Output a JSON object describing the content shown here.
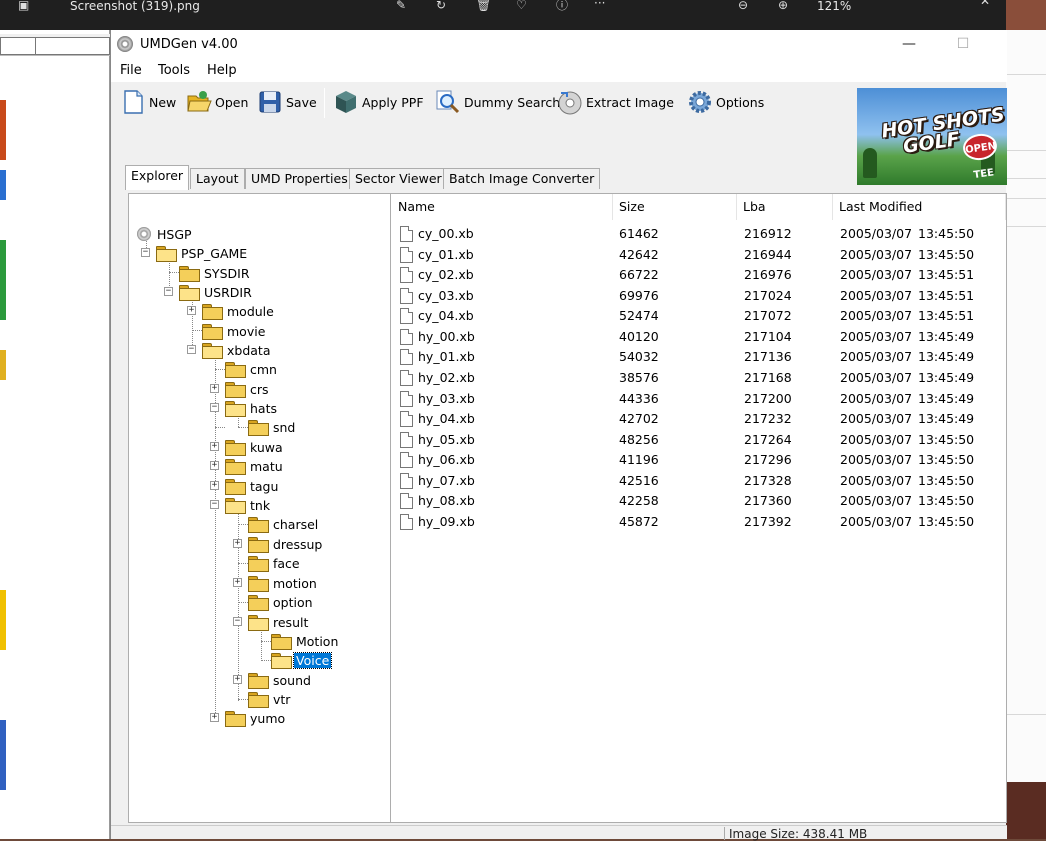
{
  "viewer": {
    "filename": "Screenshot (319).png",
    "zoom": "121%"
  },
  "window": {
    "title": "UMDGen v4.00",
    "minimize_glyph": "—",
    "maximize_glyph": "☐"
  },
  "menu": [
    "File",
    "Tools",
    "Help"
  ],
  "toolbar": {
    "new": "New",
    "open": "Open",
    "save": "Save",
    "apply_ppf": "Apply PPF",
    "dummy_search": "Dummy Search",
    "extract_image": "Extract Image",
    "options": "Options"
  },
  "banner": {
    "line1": "HOT SHOTS",
    "line2": "GOLF",
    "badge": "OPEN TEE"
  },
  "tabs": [
    "Explorer",
    "Layout",
    "UMD Properties",
    "Sector Viewer",
    "Batch Image Converter"
  ],
  "tree": {
    "root": "HSGP",
    "psp_game": "PSP_GAME",
    "sysdir": "SYSDIR",
    "usrdir": "USRDIR",
    "module": "module",
    "movie": "movie",
    "xbdata": "xbdata",
    "cmn": "cmn",
    "crs": "crs",
    "hats": "hats",
    "snd": "snd",
    "kuwa": "kuwa",
    "matu": "matu",
    "tagu": "tagu",
    "tnk": "tnk",
    "charsel": "charsel",
    "dressup": "dressup",
    "face": "face",
    "motion": "motion",
    "option": "option",
    "result": "result",
    "Motion": "Motion",
    "Voice": "Voice",
    "sound": "sound",
    "vtr": "vtr",
    "yumo": "yumo"
  },
  "list": {
    "headers": [
      "Name",
      "Size",
      "Lba",
      "Last Modified"
    ],
    "rows": [
      {
        "name": "cy_00.xb",
        "size": "61462",
        "lba": "216912",
        "date": "2005/03/07",
        "time": "13:45:50"
      },
      {
        "name": "cy_01.xb",
        "size": "42642",
        "lba": "216944",
        "date": "2005/03/07",
        "time": "13:45:50"
      },
      {
        "name": "cy_02.xb",
        "size": "66722",
        "lba": "216976",
        "date": "2005/03/07",
        "time": "13:45:51"
      },
      {
        "name": "cy_03.xb",
        "size": "69976",
        "lba": "217024",
        "date": "2005/03/07",
        "time": "13:45:51"
      },
      {
        "name": "cy_04.xb",
        "size": "52474",
        "lba": "217072",
        "date": "2005/03/07",
        "time": "13:45:51"
      },
      {
        "name": "hy_00.xb",
        "size": "40120",
        "lba": "217104",
        "date": "2005/03/07",
        "time": "13:45:49"
      },
      {
        "name": "hy_01.xb",
        "size": "54032",
        "lba": "217136",
        "date": "2005/03/07",
        "time": "13:45:49"
      },
      {
        "name": "hy_02.xb",
        "size": "38576",
        "lba": "217168",
        "date": "2005/03/07",
        "time": "13:45:49"
      },
      {
        "name": "hy_03.xb",
        "size": "44336",
        "lba": "217200",
        "date": "2005/03/07",
        "time": "13:45:49"
      },
      {
        "name": "hy_04.xb",
        "size": "42702",
        "lba": "217232",
        "date": "2005/03/07",
        "time": "13:45:49"
      },
      {
        "name": "hy_05.xb",
        "size": "48256",
        "lba": "217264",
        "date": "2005/03/07",
        "time": "13:45:50"
      },
      {
        "name": "hy_06.xb",
        "size": "41196",
        "lba": "217296",
        "date": "2005/03/07",
        "time": "13:45:50"
      },
      {
        "name": "hy_07.xb",
        "size": "42516",
        "lba": "217328",
        "date": "2005/03/07",
        "time": "13:45:50"
      },
      {
        "name": "hy_08.xb",
        "size": "42258",
        "lba": "217360",
        "date": "2005/03/07",
        "time": "13:45:50"
      },
      {
        "name": "hy_09.xb",
        "size": "45872",
        "lba": "217392",
        "date": "2005/03/07",
        "time": "13:45:50"
      }
    ]
  },
  "status": {
    "image_size": "Image Size: 438.41 MB"
  }
}
